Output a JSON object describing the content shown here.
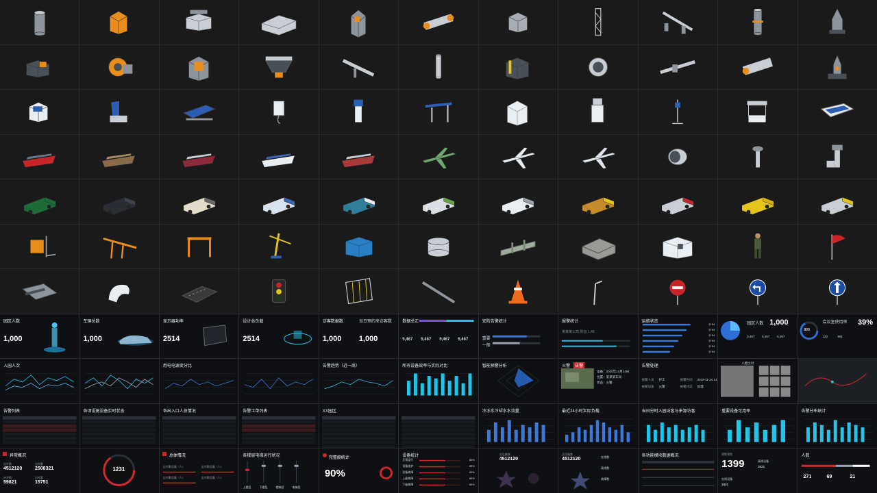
{
  "asset_library": {
    "rows": [
      [
        "tank-icon",
        "transformer-icon",
        "press-machine-icon",
        "warehouse-icon",
        "cabinet-icon",
        "drum-mill-icon",
        "cube-block-icon",
        "crane-tower-icon",
        "conveyor-icon",
        "reactor-icon",
        "silo-icon"
      ],
      [
        "crusher-icon",
        "motor-icon",
        "frame-machine-icon",
        "hopper-icon",
        "belt-conveyor-icon",
        "valve-column-icon",
        "generator-icon",
        "fan-icon",
        "pipe-icon",
        "ball-mill-icon",
        "pump-icon"
      ],
      [
        "patient-monitor-icon",
        "dental-chair-icon",
        "hospital-bed-icon",
        "wall-device-icon",
        "medical-cart-icon",
        "overbed-table-icon",
        "medicine-cabinet-icon",
        "ultrasound-icon",
        "iv-stand-icon",
        "bedside-cabinet-icon",
        "bathtub-icon"
      ],
      [
        "container-ship-icon",
        "bulk-carrier-icon",
        "tanker-ship-icon",
        "cruise-ship-icon",
        "cargo-ship-icon",
        "airplane-green-icon",
        "airplane-white-icon",
        "airliner-icon",
        "jet-engine-icon",
        "control-tower-icon",
        "airport-tower-icon"
      ],
      [
        "sedan-green-icon",
        "sports-car-icon",
        "coach-bus-icon",
        "city-bus-icon",
        "electric-bus-icon",
        "garbage-truck-icon",
        "box-truck-icon",
        "aircraft-tug-icon",
        "red-truck-icon",
        "dump-truck-icon",
        "tanker-truck-icon"
      ],
      [
        "forklift-icon",
        "gantry-crane-icon",
        "rail-gantry-icon",
        "tower-crane-icon",
        "shipping-container-icon",
        "storage-tank-icon",
        "flood-gate-icon",
        "factory-building-icon",
        "office-building-icon",
        "soldier-icon",
        "red-flag-icon"
      ],
      [
        "gangway-icon",
        "robot-arm-icon",
        "road-slab-icon",
        "traffic-light-icon",
        "barrier-gate-icon",
        "steel-beam-icon",
        "traffic-cone-icon",
        "street-lamp-icon",
        "no-entry-sign-icon",
        "turn-left-sign-icon",
        "straight-ahead-sign-icon"
      ]
    ]
  },
  "stats_row": {
    "park_people": {
      "label": "园区人数",
      "value": "1,000"
    },
    "vehicles": {
      "label": "车辆总数",
      "value": "1,000"
    },
    "screen_power": {
      "label": "显示器功率",
      "value": "2514"
    },
    "design_load": {
      "label": "设计总负载",
      "value": "2514"
    },
    "visitors": {
      "label": "访客数据数",
      "value": "1,000",
      "label2": "当日预约来访客数",
      "value2": "1,000"
    },
    "data_summary": {
      "label": "数据总汇",
      "values": [
        "5,467",
        "5,467",
        "5,467",
        "5,467"
      ]
    },
    "security_alarm": {
      "label": "安防告警统计",
      "rows": [
        "重要",
        "一般"
      ]
    },
    "fire_stats": {
      "label": "报警统计",
      "sub": "某某某公司 数值 1,48"
    },
    "running_status": {
      "label": "运维状态",
      "values": [
        "3794",
        "3794",
        "3794",
        "3794",
        "3794",
        "3794"
      ]
    },
    "park_people_pie": {
      "label": "园区人数",
      "value": "1,000",
      "values": [
        "5,467",
        "5,467",
        "5,467"
      ]
    },
    "meeting_rate": {
      "label": "会议室使用率",
      "percent": "39%",
      "ring_value": "800",
      "sub_values": [
        "120",
        "891"
      ]
    }
  },
  "charts_row": {
    "entrance_people": {
      "title": "入园人次"
    },
    "entrance_line2": {
      "title": ""
    },
    "power_dist": {
      "title": "用电电源变分比"
    },
    "line_chart4": {
      "title": ""
    },
    "alarm_trend": {
      "title": "告警趋势（近一周）"
    },
    "hot_device": {
      "title": "所有设备效率与实际对比"
    },
    "radar": {
      "title": "智能预警分析"
    },
    "fire": {
      "title": "火警",
      "badge": "告警",
      "fields": [
        "设备：2020年12月14日",
        "位置：某某某车间",
        "状态：火警"
      ]
    },
    "alarm_handle": {
      "title": "告警处理",
      "fields": [
        "报警人员",
        "报警时间",
        "报警设备",
        "报警状态"
      ],
      "values": [
        "护工",
        "2019-11-14 14:00",
        "火警",
        "处理"
      ]
    },
    "face": {
      "title": "人脸比对"
    },
    "map": {
      "title": ""
    }
  },
  "tables_row": {
    "table1": {
      "title": "告警列表"
    },
    "table2": {
      "title": "各项设施设备实时状态"
    },
    "table3": {
      "title": "各出入口人员情况"
    },
    "table4": {
      "title": "告警工单列表"
    },
    "table5": {
      "title": "XX园区"
    },
    "table6": {
      "title": ""
    },
    "water": {
      "title": "冷冻水冷却水水流量"
    },
    "load24": {
      "title": "最近24小时实际负载"
    },
    "visit_bar": {
      "title": "当日分时入园访客与来源访客"
    },
    "key_device": {
      "title": "重要设备可用率"
    },
    "alarm_dist": {
      "title": "告警分布统计"
    }
  },
  "bottom_row": {
    "abnormal": {
      "title": "异常概况",
      "items": [
        {
          "k": "出外勤",
          "v": "4512120"
        },
        {
          "k": "出外勤",
          "v": "2508321"
        },
        {
          "k": "出外勤",
          "v": "59821"
        },
        {
          "k": "出外勤",
          "v": "15751"
        }
      ]
    },
    "gauge": {
      "value": "1231",
      "label": "总报警"
    },
    "overview": {
      "title": "总体情况",
      "items": [
        "出外勤设备（人）",
        "出外勤设备（人）",
        "出外勤设备（人）",
        "出外勤设备（人）"
      ]
    },
    "sliders": {
      "title": "各楼层电梯运行状况",
      "labels": [
        "上楼层",
        "下楼层",
        "楼梯层",
        "电梯层"
      ]
    },
    "satisfaction": {
      "title": "完整度统计",
      "percent": "90%"
    },
    "list_bars": {
      "title": "设备统计",
      "rows": [
        "正常运行",
        "设备维护",
        "设备故障",
        "上级故障",
        "下级故障"
      ],
      "percents": [
        "65%",
        "65%",
        "65%",
        "65%",
        "65%"
      ]
    },
    "starmap1": {
      "title": "总设备数",
      "value": "4512120"
    },
    "starmap2": {
      "title": "总设备数",
      "value": "4512120",
      "items": [
        "在线数",
        "离线数",
        "故障数"
      ]
    },
    "bridge": {
      "title": "各功能模块数据概况"
    },
    "big_number": {
      "title": "预警预警",
      "value": "1399",
      "rows": [
        "在线设备",
        "离线设备"
      ],
      "v1": "3421",
      "v2": "3421"
    },
    "person": {
      "title": "人数",
      "values": [
        "271",
        "69",
        "21"
      ]
    }
  },
  "colors": {
    "accent": "#1ea3d6",
    "cyan": "#23c4e8",
    "red": "#d0272c",
    "panel": "#0f1013",
    "grid": "#2a2a2d"
  }
}
